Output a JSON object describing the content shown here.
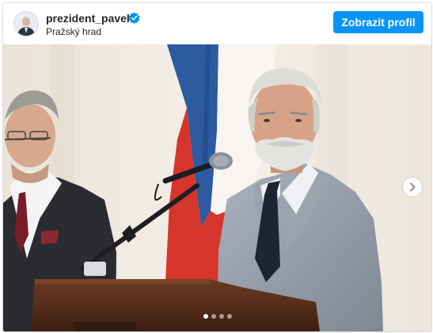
{
  "post_header": {
    "username": "prezident_pavel",
    "verified_icon": "verified-badge-icon",
    "location": "Pražský hrad",
    "profile_button_label": "Zobrazit profil"
  },
  "carousel": {
    "slide_count": 4,
    "active_index": 0,
    "next_icon": "chevron-right-icon"
  },
  "colors": {
    "button": "#0a95f6",
    "verified": "#0095f6",
    "text": "#262626"
  }
}
